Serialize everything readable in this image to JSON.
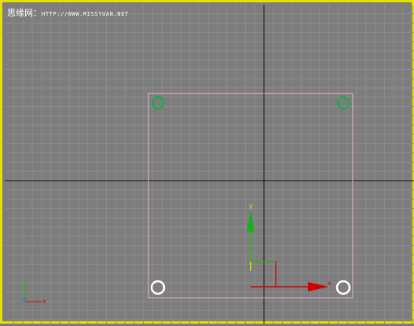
{
  "watermark": {
    "site_name": "思缘网：",
    "url": "HTTP://WWW.MISSYUAN.NET"
  },
  "gizmo": {
    "y_label": "y",
    "x_label": "x"
  },
  "view_axis": {
    "y_label": "y",
    "x_label": "x",
    "z_label": "z"
  },
  "handles": {
    "top_left_color": "#1faa4a",
    "top_right_color": "#1faa4a",
    "bottom_left_color": "#ffffff",
    "bottom_right_color": "#ffffff"
  },
  "colors": {
    "viewport_border": "#e8e000",
    "grid_minor": "#8c8c8c",
    "grid_major": "#000000",
    "selection_box": "#e8b4e0",
    "axis_y": "#20c020",
    "axis_x": "#d00000",
    "axis_y_label": "#e8e000"
  }
}
